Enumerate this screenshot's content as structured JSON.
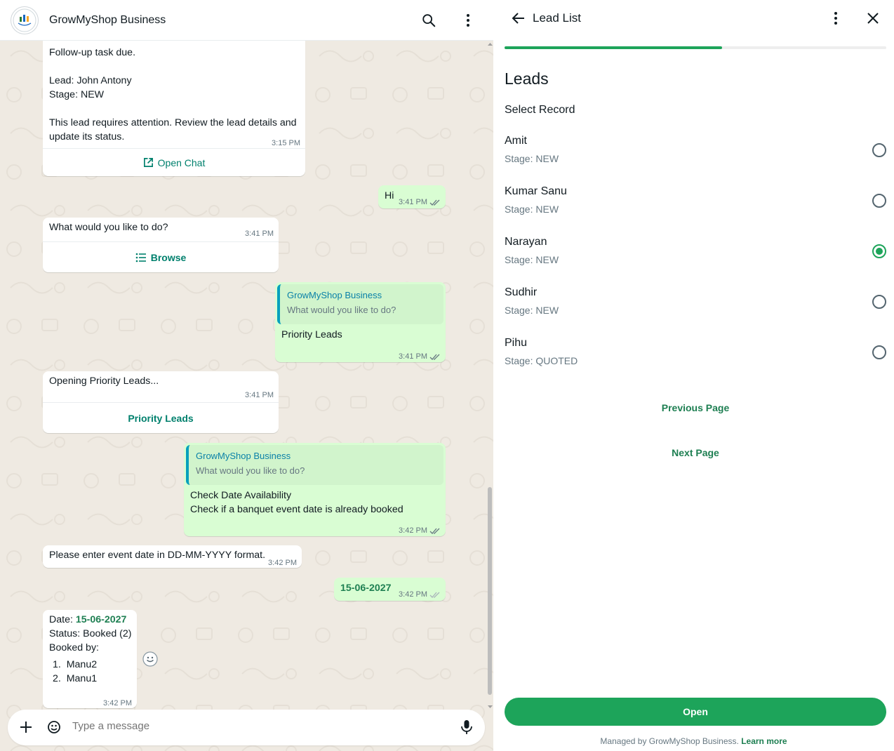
{
  "chat": {
    "title": "GrowMyShop Business",
    "composer_placeholder": "Type a message",
    "messages": [
      {
        "lines": [
          "Follow-up task due.",
          "",
          "Lead: John Antony",
          "Stage: NEW",
          "",
          "This lead requires attention. Review the lead details and",
          "update its status."
        ],
        "time": "3:15 PM",
        "button": "Open Chat"
      },
      {
        "text": "Hi",
        "time": "3:41 PM"
      },
      {
        "text": "What would you like to do?",
        "time": "3:41 PM",
        "button": "Browse"
      },
      {
        "quote_name": "GrowMyShop Business",
        "quote_text": "What would you like to do?",
        "text": "Priority Leads",
        "time": "3:41 PM"
      },
      {
        "text": "Opening Priority Leads...",
        "time": "3:41 PM",
        "button": "Priority Leads"
      },
      {
        "quote_name": "GrowMyShop Business",
        "quote_text": "What would you like to do?",
        "line1": "Check Date Availability",
        "line2": "Check if a banquet event date is already booked",
        "time": "3:42 PM"
      },
      {
        "text": "Please enter event date in DD-MM-YYYY format.",
        "time": "3:42 PM"
      },
      {
        "text": "15-06-2027",
        "time": "3:42 PM"
      },
      {
        "date_label": "Date: ",
        "date_value": "15-06-2027",
        "status": "Status: Booked (2)",
        "booked_by": "Booked by:",
        "list": [
          "1.  Manu2",
          "2.  Manu1"
        ],
        "time": "3:42 PM"
      }
    ]
  },
  "panel": {
    "title": "Lead List",
    "progress": 0.57,
    "heading": "Leads",
    "select_label": "Select Record",
    "leads": [
      {
        "name": "Amit",
        "stage": "Stage: NEW",
        "selected": false
      },
      {
        "name": "Kumar Sanu",
        "stage": "Stage: NEW",
        "selected": false
      },
      {
        "name": "Narayan",
        "stage": "Stage: NEW",
        "selected": true
      },
      {
        "name": "Sudhir",
        "stage": "Stage: NEW",
        "selected": false
      },
      {
        "name": "Pihu",
        "stage": "Stage: QUOTED",
        "selected": false
      }
    ],
    "previous_page": "Previous Page",
    "next_page": "Next Page",
    "open_button": "Open",
    "footer_text": "Managed by GrowMyShop Business.",
    "learn_more": "Learn more"
  },
  "colors": {
    "accent": "#1da45a",
    "link_green": "#1e7f52",
    "outgoing_bubble": "#d9fdd3",
    "chat_background": "#efeae2"
  }
}
